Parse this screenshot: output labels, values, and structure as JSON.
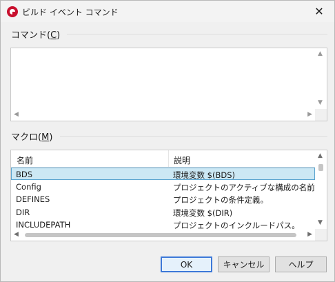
{
  "window": {
    "title": "ビルド イベント コマンド",
    "close_glyph": "✕"
  },
  "commands": {
    "label": "コマンド",
    "accelerator": "C",
    "value": ""
  },
  "macros": {
    "label": "マクロ",
    "accelerator": "M",
    "columns": [
      "名前",
      "説明"
    ],
    "rows": [
      {
        "name": "BDS",
        "description": "環境変数 $(BDS)",
        "selected": true
      },
      {
        "name": "Config",
        "description": "プロジェクトのアクティブな構成の名前",
        "selected": false
      },
      {
        "name": "DEFINES",
        "description": "プロジェクトの条件定義。",
        "selected": false
      },
      {
        "name": "DIR",
        "description": "環境変数 $(DIR)",
        "selected": false
      },
      {
        "name": "INCLUDEPATH",
        "description": "プロジェクトのインクルードパス。",
        "selected": false
      }
    ]
  },
  "buttons": {
    "ok": "OK",
    "cancel": "キャンセル",
    "help": "ヘルプ"
  },
  "icons": {
    "app": "app-logo-icon",
    "close": "close-icon"
  },
  "colors": {
    "selection_bg": "#cce8f4",
    "selection_border": "#5aa4cf",
    "default_button_border": "#3c78d8",
    "app_icon": "#c8102e"
  }
}
